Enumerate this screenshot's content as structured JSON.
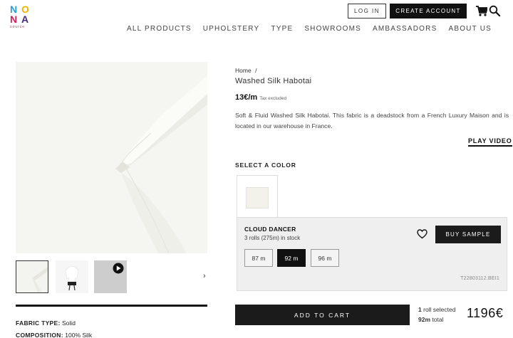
{
  "brand": {
    "logo_letters": [
      "N",
      "O",
      "N",
      "A"
    ],
    "logo_sub": "source",
    "colors": {
      "n1": "#2a9fd6",
      "o": "#f0b400",
      "n2": "#d11f5c",
      "a": "#4b2a7b"
    }
  },
  "header": {
    "login_label": "LOG IN",
    "create_account_label": "CREATE ACCOUNT",
    "icons": [
      "cart-icon",
      "search-icon"
    ]
  },
  "nav": [
    {
      "label": "ALL PRODUCTS"
    },
    {
      "label": "UPHOLSTERY"
    },
    {
      "label": "TYPE"
    },
    {
      "label": "SHOWROOMS"
    },
    {
      "label": "AMBASSADORS"
    },
    {
      "label": "ABOUT US"
    }
  ],
  "gallery": {
    "next_arrow": "›",
    "thumbnails": [
      "fabric-fold-thumbnail",
      "garment-thumbnail",
      "video-thumbnail"
    ]
  },
  "specs": [
    {
      "label": "FABRIC TYPE:",
      "value": "Solid"
    },
    {
      "label": "COMPOSITION:",
      "value": "100% Silk"
    }
  ],
  "product": {
    "breadcrumb_home": "Home",
    "breadcrumb_sep": "/",
    "title": "Washed Silk Habotai",
    "price": "13€/m",
    "tax_note": "Tax excluded",
    "description": "Soft & Fluid Washed Silk Habotai. This fabric is a deadstock from a French Luxury Maison and is located in our warehouse in France.",
    "play_video_label": "PLAY VIDEO"
  },
  "color_selector": {
    "heading": "SELECT A COLOR",
    "swatch_color": "#f2f1ea",
    "color_name": "CLOUD DANCER",
    "stock": "3 rolls (275m) in stock",
    "buy_sample_label": "BUY SAMPLE",
    "lengths": [
      {
        "label": "87 m",
        "selected": false
      },
      {
        "label": "92 m",
        "selected": true
      },
      {
        "label": "96 m",
        "selected": false
      }
    ],
    "reference": "T22803112.BEI1"
  },
  "cart": {
    "add_label": "ADD TO CART",
    "rolls_count": "1",
    "rolls_text": "roll selected",
    "meters_total": "92m",
    "meters_text": "total",
    "total_price": "1196€"
  }
}
